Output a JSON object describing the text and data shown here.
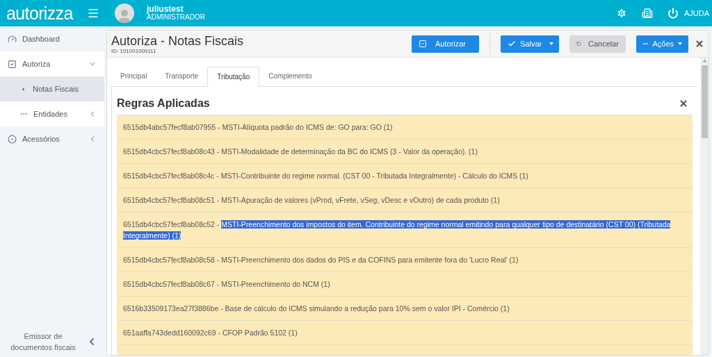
{
  "header": {
    "logo": "autorizza",
    "user": {
      "name": "juliustest",
      "role": "ADMINISTRADOR"
    },
    "help": "AJUDA"
  },
  "sidebar": {
    "items": [
      {
        "label": "Dashboard"
      },
      {
        "label": "Autoriza",
        "expanded": true,
        "children": [
          {
            "label": "Notas Fiscais",
            "selected": true
          },
          {
            "label": "Entidades",
            "selected": false,
            "expanded": false
          }
        ]
      },
      {
        "label": "Acessórios",
        "expanded": false
      }
    ],
    "footer": "Emissor de documentos fiscais"
  },
  "page": {
    "title": "Autoriza - Notas Fiscais",
    "id": "ID: 101001000111",
    "buttons": [
      {
        "kind": "primary",
        "label": "Autorizar"
      },
      {
        "kind": "split",
        "label": "Salvar"
      },
      {
        "kind": "muted",
        "label": "Cancelar"
      },
      {
        "kind": "dropdown",
        "label": "Ações"
      }
    ]
  },
  "tabs": [
    {
      "label": "Principal",
      "selected": false
    },
    {
      "label": "Transporte",
      "selected": false
    },
    {
      "label": "Tributação",
      "selected": true
    },
    {
      "label": "Complemento",
      "selected": false
    }
  ],
  "panel": {
    "title": "Regras Aplicadas",
    "rules": [
      {
        "code": "6515db4abc57fecf8ab07955",
        "separator": "-",
        "text": "MSTI-Alíquota padrão do ICMS de: GO para: GO (1)",
        "highlighted": false
      },
      {
        "code": "6515db4cbc57fecf8ab08c43",
        "separator": "-",
        "text": "MSTI-Modalidade de determinação da BC do ICMS (3 - Valor da operação). (1)",
        "highlighted": false
      },
      {
        "code": "6515db4cbc57fecf8ab08c4c",
        "separator": "-",
        "text": "MSTI-Contribuinte do regime normal. (CST 00 - Tributada Integralmente) - Cálculo do ICMS (1)",
        "highlighted": false
      },
      {
        "code": "6515db4cbc57fecf8ab08c51",
        "separator": "-",
        "text": "MSTI-Apuração de valores (vProd, vFrete, vSeg, vDesc e vOutro) de cada produto (1)",
        "highlighted": false
      },
      {
        "code": "6515db4cbc57fecf8ab08c52",
        "separator": "-",
        "text": "MSTI-Preenchimento dos impostos do item. Contribuinte do regime normal emitindo para qualquer tipo de destinatário (CST 00) (Tributada Integralmente) (1)",
        "highlighted": true
      },
      {
        "code": "6515db4cbc57fecf8ab08c58",
        "separator": "-",
        "text": "MSTI-Preenchimento dos dados do PIS e da COFINS para emitente fora do 'Lucro Real' (1)",
        "highlighted": false
      },
      {
        "code": "6515db4cbc57fecf8ab08c67",
        "separator": "-",
        "text": "MSTI-Preenchimento do NCM (1)",
        "highlighted": false
      },
      {
        "code": "6516b33509173ea27f3886be",
        "separator": "-",
        "text": "Base de cálculo do ICMS simulando a redução para 10% sem o valor IPI - Comércio (1)",
        "highlighted": false
      },
      {
        "code": "651aaffa743dedd160092c69",
        "separator": "-",
        "text": "CFOP Padrão 5102 (1)",
        "highlighted": false
      }
    ]
  }
}
